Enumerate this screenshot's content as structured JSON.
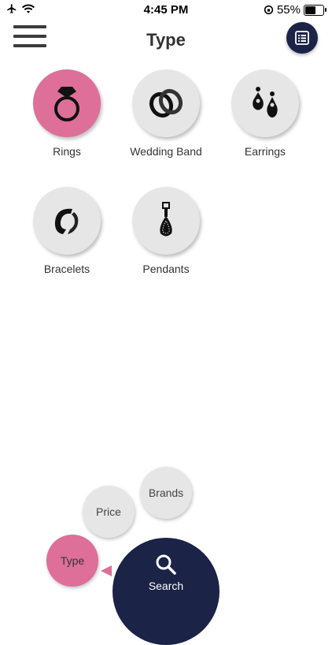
{
  "status_bar": {
    "time": "4:45 PM",
    "battery_percent": "55%"
  },
  "header": {
    "title": "Type"
  },
  "categories": [
    {
      "label": "Rings",
      "icon": "ring-icon",
      "selected": true
    },
    {
      "label": "Wedding Band",
      "icon": "wedding-band-icon",
      "selected": false
    },
    {
      "label": "Earrings",
      "icon": "earrings-icon",
      "selected": false
    },
    {
      "label": "Bracelets",
      "icon": "bracelet-icon",
      "selected": false
    },
    {
      "label": "Pendants",
      "icon": "pendant-icon",
      "selected": false
    }
  ],
  "filters": {
    "brands": "Brands",
    "price": "Price",
    "type": "Type"
  },
  "search": {
    "label": "Search"
  },
  "colors": {
    "accent_pink": "#dd6f98",
    "navy": "#1b2347",
    "chip_gray": "#e6e6e6"
  }
}
